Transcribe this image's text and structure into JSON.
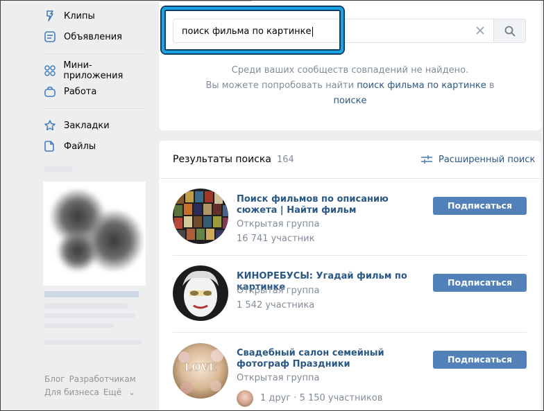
{
  "sidebar": {
    "items": [
      {
        "label": "Клипы",
        "icon": "clips-icon"
      },
      {
        "label": "Объявления",
        "icon": "ads-icon"
      },
      {
        "label": "Мини-приложения",
        "icon": "apps-icon"
      },
      {
        "label": "Работа",
        "icon": "briefcase-icon"
      },
      {
        "label": "Закладки",
        "icon": "star-icon"
      },
      {
        "label": "Файлы",
        "icon": "file-icon"
      }
    ],
    "footer": {
      "blog": "Блог",
      "developers": "Разработчикам",
      "business": "Для бизнеса",
      "more": "Ещё"
    }
  },
  "search": {
    "query": "поиск фильма по картинке"
  },
  "not_found": {
    "line1": "Среди ваших сообществ совпадений не найдено.",
    "line2_prefix": "Вы можете попробовать найти",
    "line2_link": "поиск фильма по картинке",
    "line2_suffix": "в",
    "line3_link": "поиске"
  },
  "results": {
    "title": "Результаты поиска",
    "count": "164",
    "advanced_search": "Расширенный поиск",
    "subscribe_label": "Подписаться",
    "groups": [
      {
        "name": "Поиск фильмов по описанию сюжета | Найти фильм",
        "type": "Открытая группа",
        "members": "16 741 участник"
      },
      {
        "name": "КИНОРЕБУСЫ: Угадай фильм по картинке",
        "type": "Открытая группа",
        "members": "1 542 участника"
      },
      {
        "name": "Свадебный салон семейный фотограф Праздники",
        "type": "Открытая группа",
        "members": "1 друг · 5 150 участников"
      }
    ]
  },
  "colors": {
    "accent": "#2a5885",
    "button": "#5181b8",
    "highlight": "#1aa3e8"
  }
}
